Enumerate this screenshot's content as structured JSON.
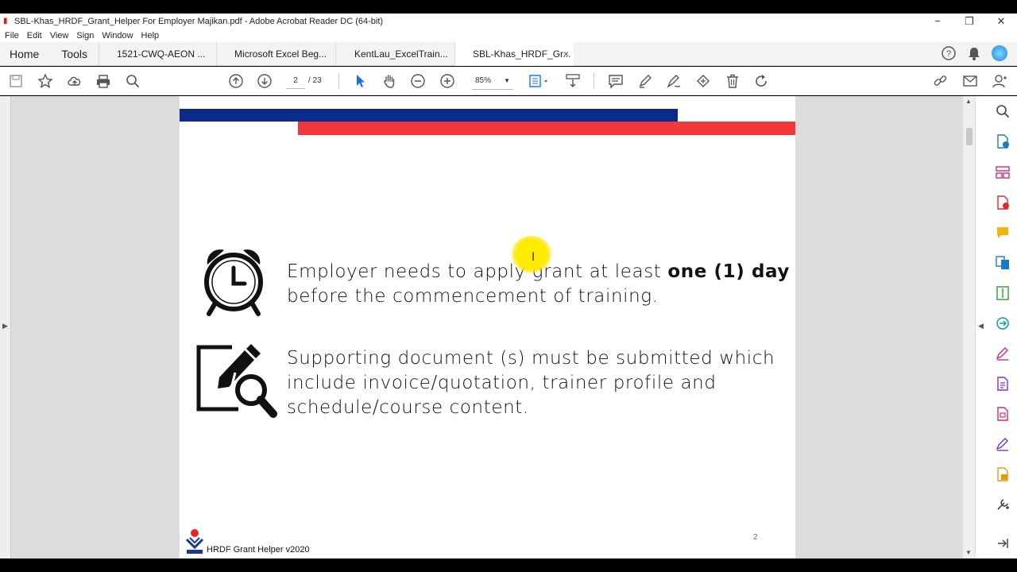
{
  "window": {
    "title": "SBL-Khas_HRDF_Grant_Helper For Employer Majikan.pdf - Adobe Acrobat Reader DC (64-bit)",
    "minimize": "−",
    "restore": "❐",
    "close": "✕"
  },
  "menu": [
    "File",
    "Edit",
    "View",
    "Sign",
    "Window",
    "Help"
  ],
  "tabs": {
    "home": "Home",
    "tools": "Tools",
    "docs": [
      "1521-CWQ-AEON ...",
      "Microsoft Excel Beg...",
      "KentLau_ExcelTrain...",
      "SBL-Khas_HRDF_Gr..."
    ],
    "close": "×"
  },
  "toolbar": {
    "page_current": "2",
    "page_total": "/ 23",
    "zoom": "85%"
  },
  "document": {
    "item1_text_a": "Employer needs to apply grant at least ",
    "item1_bold": "one (1) day",
    "item1_text_b": "before the commencement of training.",
    "item2_line1": "Supporting document (s) must be submitted which",
    "item2_line2": "include invoice/quotation, trainer profile and",
    "item2_line3": "schedule/course content.",
    "footer": "HRDF Grant Helper v2020",
    "page_number": "2"
  },
  "colors": {
    "blue_bar": "#0b2a8a",
    "red_bar": "#f1393b",
    "highlight": "#ffe900"
  }
}
